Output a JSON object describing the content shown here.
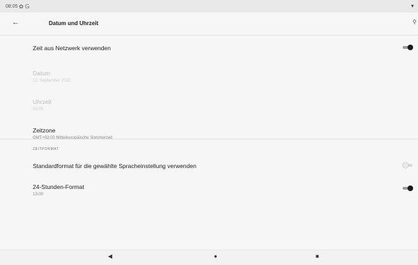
{
  "status_bar": {
    "time": "08:05",
    "icons": [
      "gear-icon",
      "g-icon"
    ],
    "wifi_icon": "wifi-icon"
  },
  "app_bar": {
    "title": "Datum und Uhrzeit",
    "back_icon": "arrow-left-icon",
    "search_icon": "search-icon"
  },
  "settings": [
    {
      "label": "Zeit aus Netzwerk verwenden",
      "switch": "on"
    },
    {
      "label": "Datum",
      "value": "12. September 2022",
      "enabled": false
    },
    {
      "label": "Uhrzeit",
      "value": "08:05",
      "enabled": false
    },
    {
      "label": "Zeitzone",
      "value": "GMT+02:00 Mitteleuropäische Sommerzeit",
      "enabled": true
    }
  ],
  "section": "ZEITFORMAT",
  "format_settings": [
    {
      "label": "Standardformat für die gewählte Spracheinstellung verwenden",
      "switch": "off"
    },
    {
      "label": "24-Stunden-Format",
      "value": "13:00",
      "switch": "on"
    }
  ],
  "nav_bar": {
    "back": "◀",
    "home": "●",
    "recents": "■"
  }
}
